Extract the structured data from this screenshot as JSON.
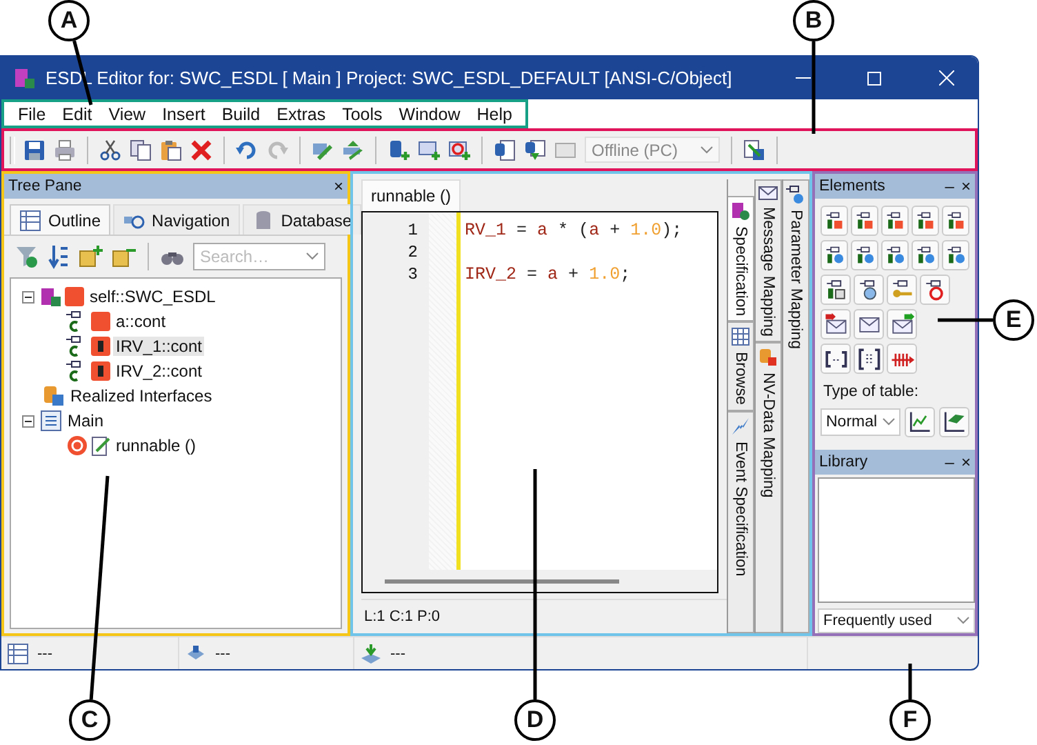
{
  "callouts": [
    {
      "label": "A"
    },
    {
      "label": "B"
    },
    {
      "label": "C"
    },
    {
      "label": "D"
    },
    {
      "label": "E"
    },
    {
      "label": "F"
    }
  ],
  "window": {
    "title": "ESDL Editor for: SWC_ESDL [ Main ] Project: SWC_ESDL_DEFAULT [ANSI-C/Object]"
  },
  "menu": [
    "File",
    "Edit",
    "View",
    "Insert",
    "Build",
    "Extras",
    "Tools",
    "Window",
    "Help"
  ],
  "toolbar": {
    "mode_dropdown": "Offline (PC)"
  },
  "tree_pane": {
    "title": "Tree Pane",
    "close": "×",
    "tabs": [
      {
        "label": "Outline",
        "selected": true
      },
      {
        "label": "Navigation",
        "selected": false
      },
      {
        "label": "Database",
        "selected": false
      }
    ],
    "search": {
      "placeholder": "Search…"
    },
    "tree": [
      {
        "label": "self::SWC_ESDL",
        "kind": "component",
        "selected": false,
        "expanded": true,
        "children": [
          {
            "label": "a::cont",
            "kind": "constant",
            "selected": false
          },
          {
            "label": "IRV_1::cont",
            "kind": "irv",
            "selected": true
          },
          {
            "label": "IRV_2::cont",
            "kind": "irv",
            "selected": false
          }
        ]
      },
      {
        "label": "Realized Interfaces",
        "kind": "interfaces",
        "selected": false
      },
      {
        "label": "Main",
        "kind": "module",
        "selected": false,
        "expanded": true,
        "children": [
          {
            "label": "runnable ()",
            "kind": "runnable",
            "selected": false
          }
        ]
      }
    ]
  },
  "editor": {
    "tab": "runnable ()",
    "lines": [
      {
        "number": "1",
        "tokens": [
          {
            "text": "RV_1",
            "kind": "ident"
          },
          {
            "text": " = ",
            "kind": "op"
          },
          {
            "text": "a",
            "kind": "ident"
          },
          {
            "text": " * (",
            "kind": "op"
          },
          {
            "text": "a",
            "kind": "ident"
          },
          {
            "text": " + ",
            "kind": "op"
          },
          {
            "text": "1.0",
            "kind": "number"
          },
          {
            "text": ");",
            "kind": "op"
          }
        ]
      },
      {
        "number": "2"
      },
      {
        "number": "3",
        "tokens": [
          {
            "text": "IRV_2",
            "kind": "ident"
          },
          {
            "text": " = ",
            "kind": "op"
          },
          {
            "text": "a",
            "kind": "ident"
          },
          {
            "text": " + ",
            "kind": "op"
          },
          {
            "text": "1.0",
            "kind": "number"
          },
          {
            "text": ";",
            "kind": "op"
          }
        ]
      }
    ],
    "status": "L:1 C:1 P:0",
    "side_tabs": [
      [
        {
          "label": "Specification",
          "selected": true
        },
        {
          "label": "Browse",
          "selected": false
        },
        {
          "label": "Event Specification",
          "selected": false
        }
      ],
      [
        {
          "label": "Message Mapping",
          "selected": false
        },
        {
          "label": "NV-Data Mapping",
          "selected": false
        }
      ],
      [
        {
          "label": "Parameter Mapping",
          "selected": false
        }
      ]
    ]
  },
  "elements_pane": {
    "title": "Elements",
    "minimize": "–",
    "close": "×",
    "table_type_label": "Type of table:",
    "table_type": "Normal"
  },
  "library_pane": {
    "title": "Library",
    "minimize": "–",
    "close": "×",
    "filter": "Frequently used"
  },
  "status_bar": [
    "---",
    "---",
    "---"
  ]
}
